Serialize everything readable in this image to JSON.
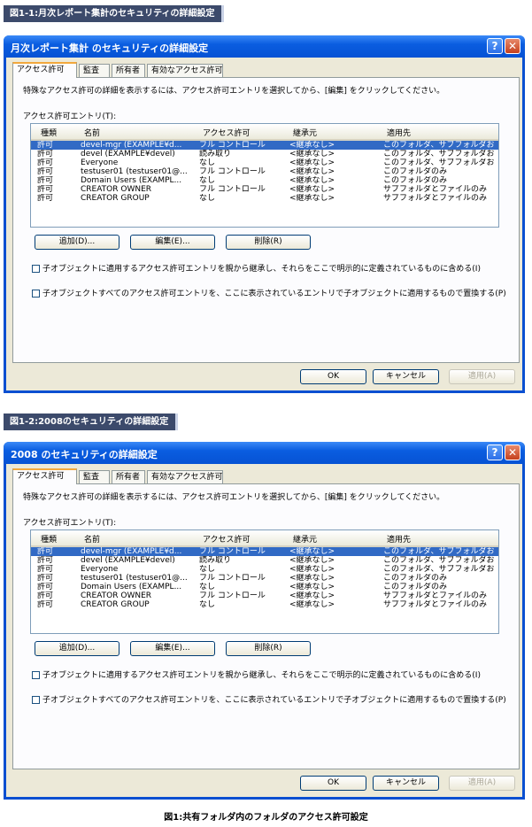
{
  "figures": [
    {
      "caption": "図1-1:月次レポート集計のセキュリティの詳細設定",
      "window_title": "月次レポート集計 のセキュリティの詳細設定"
    },
    {
      "caption": "図1-2:2008のセキュリティの詳細設定",
      "window_title": "2008 のセキュリティの詳細設定"
    }
  ],
  "window": {
    "help_glyph": "?",
    "close_glyph": "✕",
    "tabs": [
      "アクセス許可",
      "監査",
      "所有者",
      "有効なアクセス許可"
    ],
    "description": "特殊なアクセス許可の詳細を表示するには、アクセス許可エントリを選択してから、[編集] をクリックしてください。",
    "list_label": "アクセス許可エントリ(T):",
    "columns": [
      "種類",
      "名前",
      "アクセス許可",
      "継承元",
      "適用先"
    ],
    "rows": [
      [
        "許可",
        "devel-mgr (EXAMPLE¥d...",
        "フル コントロール",
        "<継承なし>",
        "このフォルダ、サブフォルダお..."
      ],
      [
        "許可",
        "devel (EXAMPLE¥devel)",
        "読み取り",
        "<継承なし>",
        "このフォルダ、サブフォルダお..."
      ],
      [
        "許可",
        "Everyone",
        "なし",
        "<継承なし>",
        "このフォルダ、サブフォルダお..."
      ],
      [
        "許可",
        "testuser01 (testuser01@...",
        "フル コントロール",
        "<継承なし>",
        "このフォルダのみ"
      ],
      [
        "許可",
        "Domain Users (EXAMPL...",
        "なし",
        "<継承なし>",
        "このフォルダのみ"
      ],
      [
        "許可",
        "CREATOR OWNER",
        "フル コントロール",
        "<継承なし>",
        "サブフォルダとファイルのみ"
      ],
      [
        "許可",
        "CREATOR GROUP",
        "なし",
        "<継承なし>",
        "サブフォルダとファイルのみ"
      ]
    ],
    "add_label": "追加(D)...",
    "edit_label": "編集(E)...",
    "delete_label": "削除(R)",
    "check_inherit": "子オブジェクトに適用するアクセス許可エントリを親から継承し、それらをここで明示的に定義されているものに含める(I)",
    "check_replace": "子オブジェクトすべてのアクセス許可エントリを、ここに表示されているエントリで子オブジェクトに適用するもので置換する(P)",
    "ok_label": "OK",
    "cancel_label": "キャンセル",
    "apply_label": "適用(A)"
  },
  "footer_caption": "図1:共有フォルダ内のフォルダのアクセス許可設定",
  "colors": {
    "title_bar": "#0a5de0",
    "selection": "#316ac5",
    "dialog_bg": "#ece9d8"
  }
}
